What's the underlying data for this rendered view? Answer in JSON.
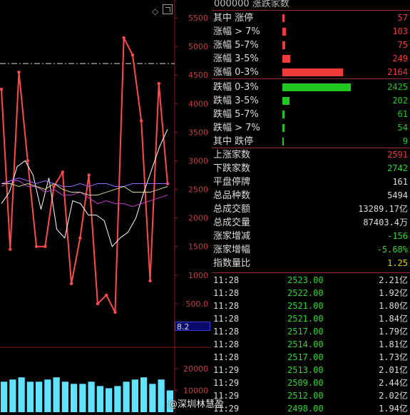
{
  "header": {
    "partial_title": "000000 涨跌家数"
  },
  "icons": {
    "diamond": "diamond-icon",
    "window": "restore-window-icon"
  },
  "colors": {
    "rise": "#ef3b3b",
    "fall": "#22c722",
    "grid": "#8a1e1e",
    "up_line": "#ff4a4a",
    "white_line": "#ffffff"
  },
  "chart_data": {
    "type": "line",
    "yaxis_ticks": [
      "5500",
      "5000",
      "4500",
      "4000",
      "3500",
      "3000",
      "2500",
      "2000",
      "1500",
      "1000",
      "500.0"
    ],
    "cursor_label": "8.2",
    "volume_ticks": [
      "20000",
      "10000"
    ],
    "series": [
      {
        "values": [
          4250,
          1450,
          4550,
          3000,
          1500,
          1500,
          2550,
          2800,
          850,
          1650,
          2750,
          500,
          650,
          350,
          5150,
          4850,
          3700,
          900,
          4350,
          2600
        ]
      },
      {
        "values": [
          2250,
          2450,
          2900,
          3000,
          2750,
          2150,
          2700,
          1800,
          1650,
          2300,
          2250,
          2050,
          2050,
          1950,
          1500,
          1650,
          1750,
          2000,
          2450,
          2850,
          3250,
          3550
        ]
      },
      {
        "values": [
          2600,
          2650,
          2700,
          2650,
          2600,
          2650,
          2600,
          2550,
          2550,
          2600,
          2550,
          2600,
          2600,
          2550,
          2550,
          2600,
          2600,
          2600,
          2600,
          2600
        ]
      },
      {
        "values": [
          2550,
          2650,
          2650,
          2550,
          2550,
          2450,
          2500,
          2400,
          2400,
          2450,
          2350,
          2250,
          2300,
          2250,
          2250,
          2200,
          2250,
          2300,
          2350,
          2400
        ]
      },
      {
        "values": [
          2600,
          2600,
          2550,
          2600,
          2550,
          2500,
          2600,
          2500,
          2450,
          2450,
          2400,
          2400,
          2450,
          2500,
          2550,
          2450,
          2450,
          2450,
          2500,
          2550
        ]
      }
    ],
    "volume": [
      14000,
      15000,
      16000,
      14000,
      14000,
      15000,
      16000,
      14000,
      13000,
      13000,
      14000,
      12000,
      11000,
      12000,
      14000,
      15000,
      16000,
      13000,
      15000,
      10000
    ]
  },
  "market_stats": [
    {
      "label": "其中 涨停",
      "value": "57",
      "side": "up",
      "bar": 0.03
    },
    {
      "label": "涨幅 > 7%",
      "value": "103",
      "side": "up",
      "bar": 0.05
    },
    {
      "label": "涨幅 5-7%",
      "value": "75",
      "side": "up",
      "bar": 0.04
    },
    {
      "label": "涨幅 3-5%",
      "value": "249",
      "side": "up",
      "bar": 0.11
    },
    {
      "label": "涨幅 0-3%",
      "value": "2164",
      "side": "up",
      "bar": 0.89
    },
    {
      "label": "跌幅 0-3%",
      "value": "2425",
      "side": "down",
      "bar": 1.0
    },
    {
      "label": "跌幅 3-5%",
      "value": "202",
      "side": "down",
      "bar": 0.1
    },
    {
      "label": "跌幅 5-7%",
      "value": "61",
      "side": "down",
      "bar": 0.03
    },
    {
      "label": "跌幅 > 7%",
      "value": "54",
      "side": "down",
      "bar": 0.03
    },
    {
      "label": "其中 跌停",
      "value": "9",
      "side": "down",
      "bar": 0.01
    }
  ],
  "summary": [
    {
      "label": "上涨家数",
      "value": "2591",
      "color": "#ef3b3b"
    },
    {
      "label": "下跌家数",
      "value": "2742",
      "color": "#2fd52f"
    },
    {
      "label": "平盘停牌",
      "value": "161",
      "color": "#ddd"
    },
    {
      "label": "总品种数",
      "value": "5494",
      "color": "#ddd"
    },
    {
      "label": "总成交额",
      "value": "13289.17亿",
      "color": "#ddd"
    },
    {
      "label": "总成交量",
      "value": "87403.4万",
      "color": "#ddd"
    },
    {
      "label": "涨家增减",
      "value": "-156",
      "color": "#2fd52f"
    },
    {
      "label": "涨家增幅",
      "value": "-5.68%",
      "color": "#2fd52f"
    },
    {
      "label": "指数量比",
      "value": "1.25",
      "color": "#e0d000"
    }
  ],
  "ticks": [
    {
      "time": "11:28",
      "price": "2523.00",
      "amount": "2.21亿"
    },
    {
      "time": "11:28",
      "price": "2522.00",
      "amount": "1.92亿"
    },
    {
      "time": "11:28",
      "price": "2521.00",
      "amount": "1.80亿"
    },
    {
      "time": "11:28",
      "price": "2521.00",
      "amount": "1.84亿"
    },
    {
      "time": "11:28",
      "price": "2517.00",
      "amount": "1.79亿"
    },
    {
      "time": "11:28",
      "price": "2514.00",
      "amount": "1.81亿"
    },
    {
      "time": "11:28",
      "price": "2517.00",
      "amount": "1.73亿"
    },
    {
      "time": "11:29",
      "price": "2513.00",
      "amount": "2.01亿"
    },
    {
      "time": "11:29",
      "price": "2509.00",
      "amount": "2.44亿"
    },
    {
      "time": "11:29",
      "price": "2512.00",
      "amount": "2.02亿"
    },
    {
      "time": "11:29",
      "price": "2498.00",
      "amount": "1.94亿"
    }
  ],
  "watermark": "@深圳林慧盈"
}
